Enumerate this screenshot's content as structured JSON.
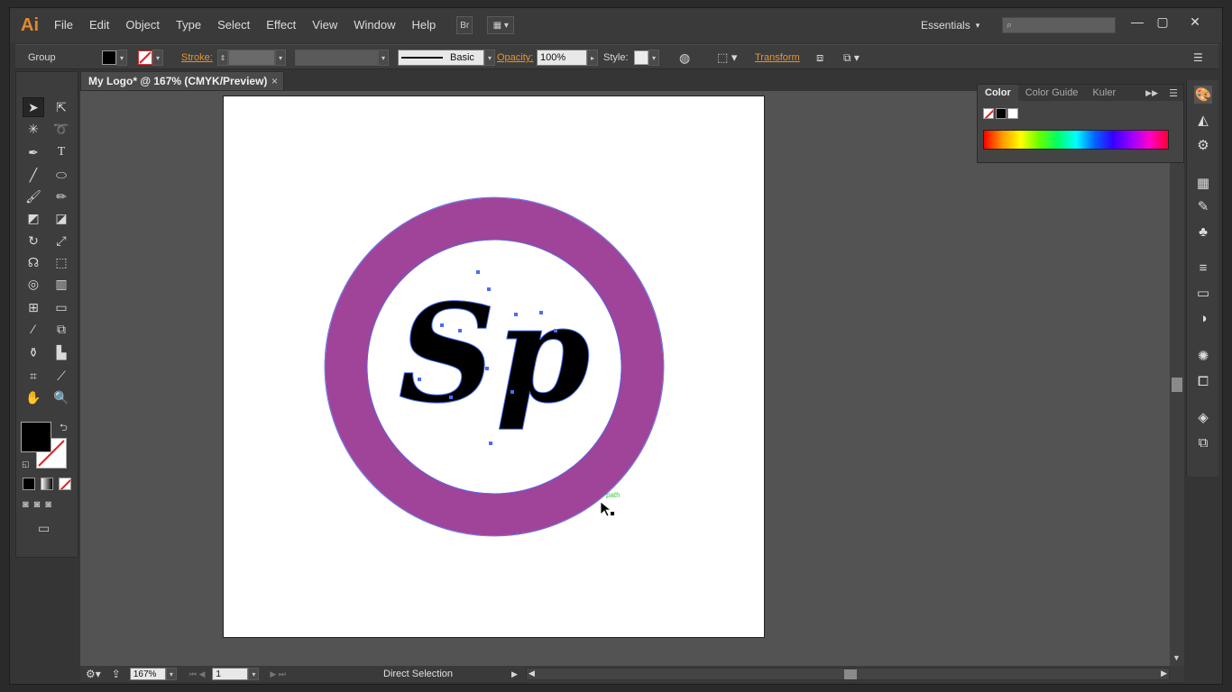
{
  "app": {
    "logo": "Ai"
  },
  "menu": {
    "items": [
      "File",
      "Edit",
      "Object",
      "Type",
      "Select",
      "Effect",
      "View",
      "Window",
      "Help"
    ]
  },
  "bridge_button": "Br",
  "workspace": "Essentials",
  "control_bar": {
    "selection_type": "Group",
    "stroke_label": "Stroke:",
    "brush_label": "Basic",
    "opacity_label": "Opacity:",
    "opacity_value": "100%",
    "style_label": "Style:",
    "transform_label": "Transform"
  },
  "document": {
    "tab_title": "My Logo* @ 167% (CMYK/Preview)",
    "close": "×"
  },
  "artwork": {
    "letters": "Sp",
    "ring_color": "#a0449a",
    "cursor_hint": "path"
  },
  "color_panel": {
    "tabs": [
      "Color",
      "Color Guide",
      "Kuler"
    ]
  },
  "status_bar": {
    "zoom": "167%",
    "page": "1",
    "tool_name": "Direct Selection"
  },
  "colors": {
    "accent": "#e8922e",
    "ring": "#a0449a",
    "selection": "#4a6cf7"
  }
}
